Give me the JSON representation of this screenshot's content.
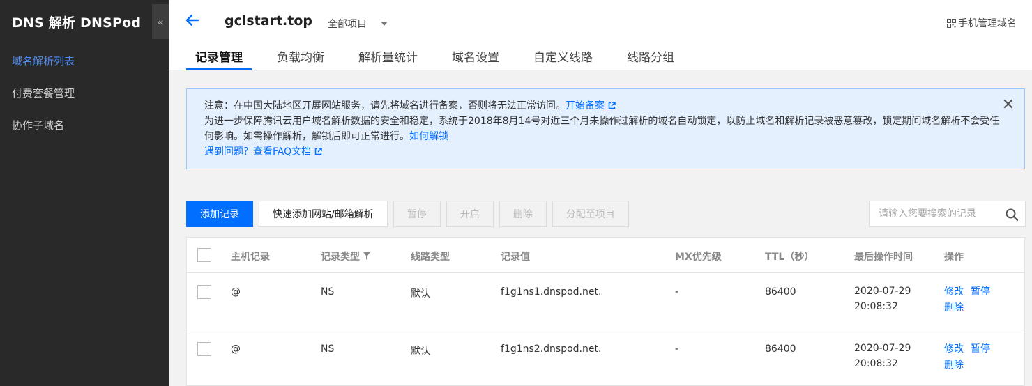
{
  "sidebar": {
    "title": "DNS 解析 DNSPod",
    "collapse_label": "«",
    "items": [
      {
        "label": "域名解析列表"
      },
      {
        "label": "付费套餐管理"
      },
      {
        "label": "协作子域名"
      }
    ]
  },
  "header": {
    "domain": "gclstart.top",
    "project_select": "全部项目",
    "mobile_link": "手机管理域名",
    "tabs": [
      {
        "label": "记录管理"
      },
      {
        "label": "负载均衡"
      },
      {
        "label": "解析量统计"
      },
      {
        "label": "域名设置"
      },
      {
        "label": "自定义线路"
      },
      {
        "label": "线路分组"
      }
    ]
  },
  "notice": {
    "line1": "注意：在中国大陆地区开展网站服务，请先将域名进行备案，否则将无法正常访问。",
    "line1_link": "开始备案",
    "line2": "为进一步保障腾讯云用户域名解析数据的安全和稳定，系统于2018年8月14号对近三个月未操作过解析的域名自动锁定，以防止域名和解析记录被恶意篡改，锁定期间域名解析不会受任何影响。如需操作解析，解锁后即可正常进行。",
    "line2_link": "如何解锁",
    "line3": "遇到问题？",
    "line3_link": "查看FAQ文档"
  },
  "toolbar": {
    "add_record": "添加记录",
    "quick_add": "快速添加网站/邮箱解析",
    "pause": "暂停",
    "enable": "开启",
    "delete": "删除",
    "assign": "分配至项目"
  },
  "search": {
    "placeholder": "请输入您要搜索的记录"
  },
  "table": {
    "columns": {
      "host": "主机记录",
      "type": "记录类型",
      "line": "线路类型",
      "value": "记录值",
      "mx": "MX优先级",
      "ttl": "TTL（秒）",
      "time": "最后操作时间",
      "ops": "操作"
    },
    "rows": [
      {
        "host": "@",
        "type": "NS",
        "line": "默认",
        "value": "f1g1ns1.dnspod.net.",
        "mx": "-",
        "ttl": "86400",
        "date": "2020-07-29",
        "clock": "20:08:32",
        "edit": "修改",
        "pause": "暂停",
        "delete": "删除"
      },
      {
        "host": "@",
        "type": "NS",
        "line": "默认",
        "value": "f1g1ns2.dnspod.net.",
        "mx": "-",
        "ttl": "86400",
        "date": "2020-07-29",
        "clock": "20:08:32",
        "edit": "修改",
        "pause": "暂停",
        "delete": "删除"
      }
    ]
  },
  "colors": {
    "accent": "#006eff",
    "sidebar_bg": "#292929",
    "notice_bg": "#e5f0ff"
  }
}
